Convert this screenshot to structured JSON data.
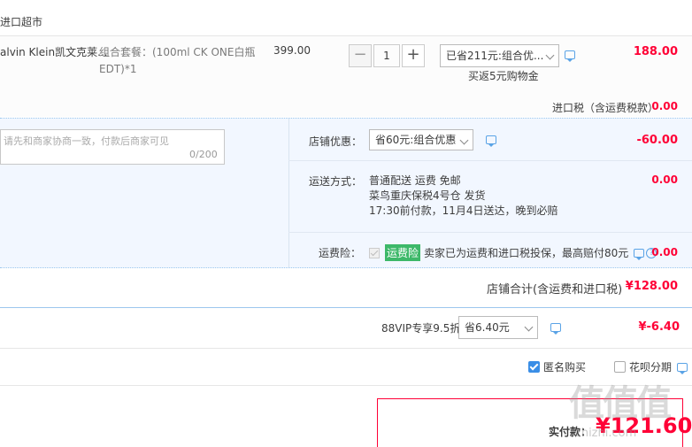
{
  "store": {
    "name": "进口超市"
  },
  "item": {
    "name": "alvin Klein凯文克莱...",
    "sku": "组合套餐：(100ml CK ONE白瓶EDT)*1",
    "unit_price": "399.00",
    "quantity": "1",
    "qty_minus": "−",
    "qty_plus": "+",
    "promo_select": "已省211元:组合优...",
    "promo_note": "买返5元购物金",
    "subtotal": "188.00"
  },
  "tax": {
    "label": "进口税（含运费税款）",
    "value": "0.00"
  },
  "message": {
    "placeholder": "请先和商家协商一致，付款后商家可见",
    "counter": "0/200"
  },
  "shop_discount": {
    "label": "店铺优惠：",
    "select": "省60元:组合优惠",
    "value": "-60.00"
  },
  "shipping": {
    "label": "运送方式：",
    "line1": "普通配送 运费 免邮",
    "line2": "菜鸟重庆保税4号仓  发货",
    "line3": "17:30前付款，11月4日送达，晚到必赔",
    "value": "0.00"
  },
  "insurance": {
    "label": "运费险：",
    "badge": "运费险",
    "text": "卖家已为运费和进口税投保，最高赔付80元",
    "help": "?",
    "value": "0.00"
  },
  "store_total": {
    "label": "店铺合计(含运费和进口税)",
    "value": "¥128.00"
  },
  "vip": {
    "label": "88VIP专享9.5折",
    "select": "省6.40元",
    "value": "¥-6.40"
  },
  "options": {
    "anonymous": "匿名购买",
    "huabei": "花呗分期"
  },
  "payment": {
    "label": "实付款：",
    "value": "¥121.60"
  },
  "watermark": {
    "glyphs": "值值值",
    "site": "zhizhi.com"
  },
  "colors": {
    "price_red": "#ff0036",
    "accent_blue": "#3a8ee6",
    "panel_bg": "#f2f7ff",
    "insurance_green": "#3db869"
  },
  "icons": [
    "chat-icon",
    "chevron-down-icon",
    "help-icon",
    "checkbox-icon"
  ]
}
